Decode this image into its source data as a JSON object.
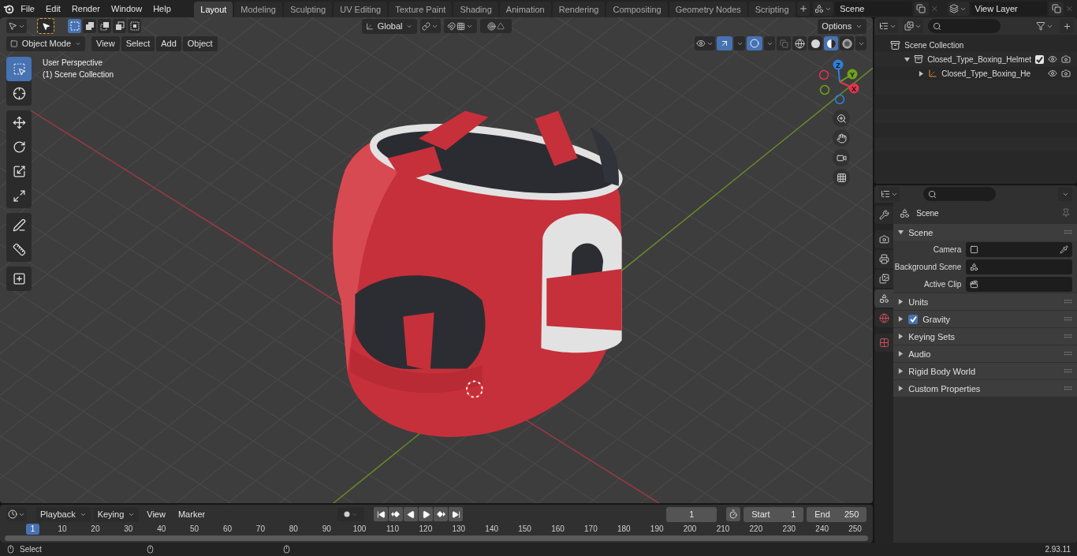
{
  "menu": [
    "File",
    "Edit",
    "Render",
    "Window",
    "Help"
  ],
  "workspaces": [
    {
      "label": "Layout",
      "selected": true
    },
    {
      "label": "Modeling",
      "selected": false
    },
    {
      "label": "Sculpting",
      "selected": false
    },
    {
      "label": "UV Editing",
      "selected": false
    },
    {
      "label": "Texture Paint",
      "selected": false
    },
    {
      "label": "Shading",
      "selected": false
    },
    {
      "label": "Animation",
      "selected": false
    },
    {
      "label": "Rendering",
      "selected": false
    },
    {
      "label": "Compositing",
      "selected": false
    },
    {
      "label": "Geometry Nodes",
      "selected": false
    },
    {
      "label": "Scripting",
      "selected": false
    }
  ],
  "scene": {
    "value": "Scene"
  },
  "view_layer": {
    "value": "View Layer"
  },
  "viewport": {
    "select_modes": [
      {
        "kind": "set",
        "selected": true
      },
      {
        "kind": "extend",
        "selected": false
      },
      {
        "kind": "subtract",
        "selected": false
      },
      {
        "kind": "difference",
        "selected": false
      },
      {
        "kind": "intersect",
        "selected": false
      }
    ],
    "orientation": "Global",
    "options": "Options",
    "mode": "Object Mode",
    "menus": [
      "View",
      "Select",
      "Add",
      "Object"
    ],
    "gizmos_on": true,
    "overlays_on": true,
    "shading": [
      {
        "kind": "wireframe",
        "selected": false
      },
      {
        "kind": "solid",
        "selected": false
      },
      {
        "kind": "material",
        "selected": true
      },
      {
        "kind": "rendered",
        "selected": false
      }
    ],
    "info": [
      "User Perspective",
      "(1) Scene Collection"
    ],
    "tools": [
      {
        "kind": "select",
        "selected": true
      },
      {
        "kind": "cursor",
        "selected": false
      },
      {
        "kind": "move",
        "selected": false
      },
      {
        "kind": "rotate",
        "selected": false
      },
      {
        "kind": "scale",
        "selected": false
      },
      {
        "kind": "transform",
        "selected": false
      },
      {
        "kind": "annotate",
        "selected": false
      },
      {
        "kind": "measure",
        "selected": false
      },
      {
        "kind": "add-cube",
        "selected": false
      }
    ],
    "gizmo": [
      {
        "label": "Z",
        "color": "#2e7fdc"
      },
      {
        "label": "Y",
        "color": "#6ea419"
      },
      {
        "label": "X",
        "color": "#e0344b"
      }
    ]
  },
  "outliner": {
    "items": [
      {
        "kind": "scene-collection",
        "label": "Scene Collection",
        "children": [
          {
            "kind": "collection",
            "label": "Closed_Type_Boxing_Helmet",
            "expanded": true,
            "checked": true,
            "children": [
              {
                "kind": "empty",
                "label": "Closed_Type_Boxing_He",
                "expanded": false
              }
            ]
          }
        ]
      }
    ]
  },
  "properties": {
    "tabs": [
      {
        "kind": "tool",
        "selected": false
      },
      {
        "kind": "render",
        "selected": false
      },
      {
        "kind": "output",
        "selected": false
      },
      {
        "kind": "view-layer",
        "selected": false
      },
      {
        "kind": "scene",
        "selected": true
      },
      {
        "kind": "world",
        "selected": false
      },
      {
        "kind": "texture",
        "selected": false
      }
    ],
    "context": "Scene",
    "panel": {
      "title": "Scene",
      "expanded": true,
      "fields": [
        {
          "label": "Camera",
          "kind": "camera"
        },
        {
          "label": "Background Scene",
          "kind": "scene"
        },
        {
          "label": "Active Clip",
          "kind": "clip"
        }
      ]
    },
    "subpanels": [
      {
        "label": "Units",
        "expanded": false
      },
      {
        "label": "Gravity",
        "expanded": false,
        "checked": true
      },
      {
        "label": "Keying Sets",
        "expanded": false
      },
      {
        "label": "Audio",
        "expanded": false
      },
      {
        "label": "Rigid Body World",
        "expanded": false
      },
      {
        "label": "Custom Properties",
        "expanded": false
      }
    ]
  },
  "timeline": {
    "menus": [
      {
        "label": "Playback",
        "kind": "dropdown"
      },
      {
        "label": "Keying",
        "kind": "dropdown"
      },
      {
        "label": "View",
        "kind": "menu"
      },
      {
        "label": "Marker",
        "kind": "menu"
      }
    ],
    "current_frame": "1",
    "start": {
      "label": "Start",
      "value": "1"
    },
    "end": {
      "label": "End",
      "value": "250"
    },
    "playhead": "1",
    "ruler": [
      "10",
      "20",
      "30",
      "40",
      "50",
      "60",
      "70",
      "80",
      "90",
      "100",
      "110",
      "120",
      "130",
      "140",
      "150",
      "160",
      "170",
      "180",
      "190",
      "200",
      "210",
      "220",
      "230",
      "240",
      "250"
    ]
  },
  "status": {
    "action": "Select",
    "version": "2.93.11"
  }
}
